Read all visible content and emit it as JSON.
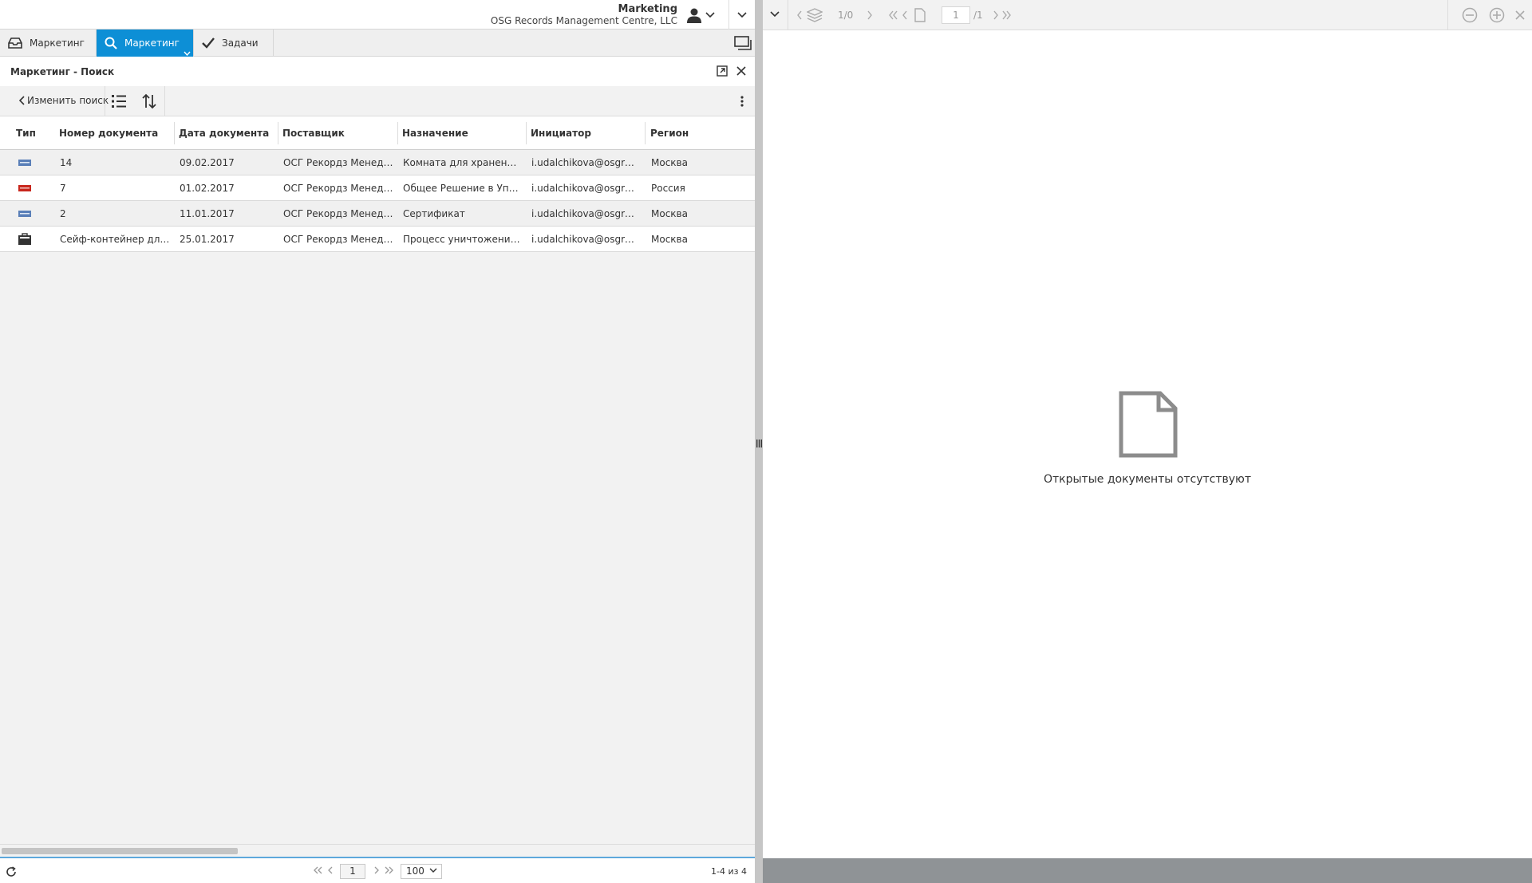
{
  "header": {
    "org_name": "Marketing",
    "org_company": "OSG Records Management Centre, LLC"
  },
  "tabs": [
    {
      "label": "Маркетинг",
      "icon": "inbox-icon"
    },
    {
      "label": "Маркетинг",
      "icon": "search-icon"
    },
    {
      "label": "Задачи",
      "icon": "checkmark-icon"
    }
  ],
  "panel": {
    "title": "Маркетинг - Поиск"
  },
  "toolbar": {
    "back_label": "Изменить поиск"
  },
  "table": {
    "columns": [
      "Тип",
      "Номер документа",
      "Дата документа",
      "Поставщик",
      "Назначение",
      "Инициатор",
      "Регион"
    ],
    "rows": [
      {
        "type": "document-icon",
        "number": "14",
        "date": "09.02.2017",
        "supplier": "ОСГ Рекордз Менедж...",
        "purpose": "Комната для хранения...",
        "initiator": "i.udalchikova@osgrm.ru",
        "region": "Москва"
      },
      {
        "type": "pdf-icon",
        "number": "7",
        "date": "01.02.2017",
        "supplier": "ОСГ Рекордз Менедж...",
        "purpose": "Общее Решение в Управ...",
        "initiator": "i.udalchikova@osgrm.ru",
        "region": "Россия"
      },
      {
        "type": "document-icon",
        "number": "2",
        "date": "11.01.2017",
        "supplier": "ОСГ Рекордз Менедж...",
        "purpose": "Сертификат",
        "initiator": "i.udalchikova@osgrm.ru",
        "region": "Москва"
      },
      {
        "type": "folder-icon",
        "number": "Сейф-контейнер для у...",
        "date": "25.01.2017",
        "supplier": "ОСГ Рекордз Менедж...",
        "purpose": "Процесс уничтожения д...",
        "initiator": "i.udalchikova@osgrm.ru",
        "region": "Москва"
      }
    ]
  },
  "pager": {
    "page": "1",
    "page_size": "100",
    "count": "1-4 из 4"
  },
  "viewer": {
    "layer_count": "1/0",
    "page_input": "1",
    "page_total": "/1",
    "empty_message": "Открытые документы отсутствуют"
  },
  "colors": {
    "accent": "#0d8fd6",
    "pdf_red": "#c8261c",
    "doc_blue": "#5a7fb8"
  }
}
